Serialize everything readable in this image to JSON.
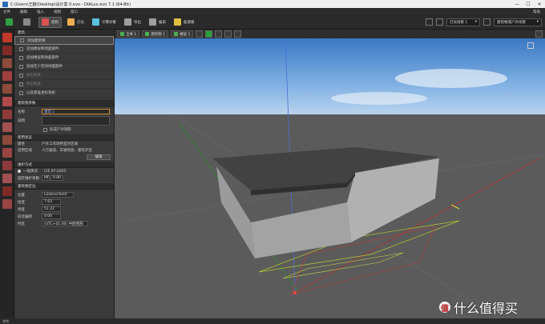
{
  "window": {
    "title": "C:\\Users\\王蒯\\Desktop\\设计案 0.evo - DIALux evo 7.1 (64-Bit)",
    "minimize": "—",
    "maximize": "☐",
    "close": "✕"
  },
  "menu": {
    "items": [
      "文件",
      "编辑",
      "插入",
      "视图",
      "窗口"
    ],
    "help": "帮助"
  },
  "toolbar": {
    "buttons": [
      {
        "label": "",
        "color": "#2ea043"
      },
      {
        "label": "",
        "color": "#8a8a8a"
      },
      {
        "label": "结构",
        "color": "#d9534f"
      },
      {
        "label": "灯光",
        "color": "#f0ad4e"
      },
      {
        "label": "计算对象",
        "color": "#5bc0de"
      },
      {
        "label": "导出",
        "color": "#9e9e9e"
      },
      {
        "label": "报表",
        "color": "#9e9e9e"
      },
      {
        "label": "能源版",
        "color": "#e0c040"
      }
    ],
    "select_light": "灯光场景 1",
    "select_mode": "建筑物或户外场景"
  },
  "views": {
    "tabs": [
      "全体 1",
      "建筑物 1",
      "楼层 1"
    ]
  },
  "panel": {
    "header": "建筑",
    "actions": [
      {
        "label": "添加建筑物",
        "state": "selected"
      },
      {
        "label": "追加楼层和地面部件",
        "state": "normal"
      },
      {
        "label": "追加楼层和地面部件",
        "state": "normal"
      },
      {
        "label": "追加至少空间地面部件",
        "state": "normal"
      },
      {
        "label": "模型要素",
        "state": "dim"
      },
      {
        "label": "模型要素",
        "state": "dim"
      },
      {
        "label": "以此基准坐标系统",
        "state": "normal"
      }
    ],
    "building": {
      "section": "建筑物参数",
      "name_label": "名称",
      "name_value": "建筑 1",
      "desc_label": "说明",
      "desc_value": "",
      "shadow_label": "形成户外阴影"
    },
    "use": {
      "section": "使用状态",
      "type_label": "属性",
      "type_value": "户外工作场所室外区域",
      "area_label": "适用区域",
      "area_value": "人行通道、车辆停放、建筑外区",
      "edit_button": "编辑"
    },
    "maint": {
      "section": "维护方式",
      "mode_label": "一般情况",
      "mode_value": "CIE 97:2005",
      "factor_label": "固定维护系数",
      "factor_prefix": "MF",
      "factor_value": "0.80"
    },
    "location": {
      "section": "建筑物定位",
      "site_label": "位置",
      "site_value": "Lüdenscheid",
      "lon_label": "经度",
      "lon_value": "7.63",
      "lat_label": "纬度",
      "lat_value": "51.22",
      "north_label": "向北偏转",
      "north_value": "0.00",
      "tz_label": "时区",
      "tz_value": "(UTC+01:00) 中欧西部"
    }
  },
  "watermark": {
    "circle": "值",
    "text": "什么值得买"
  },
  "status": {
    "text": "就绪"
  },
  "colors": {
    "sky_top": "#3a78c4",
    "ground": "#5b5b5b",
    "roof": "#3f3f3f",
    "wall": "#a9a9a9",
    "accent_orange": "#d28a2f"
  }
}
